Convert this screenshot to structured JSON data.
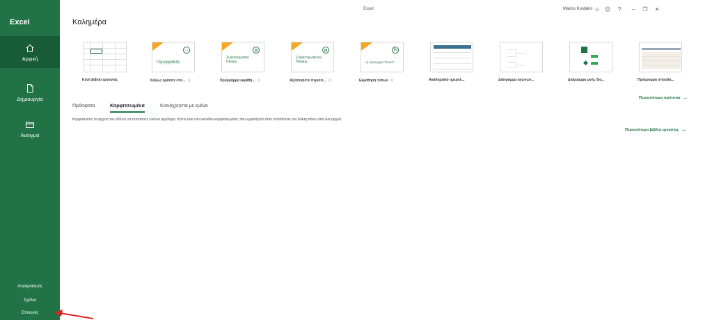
{
  "app": {
    "name": "Excel",
    "window_title": "Excel",
    "user_name": "Marios Kostakis",
    "brand_color": "#217346",
    "brand_dark": "#185c37"
  },
  "titlebar": {
    "buttons": [
      {
        "icon": "smiley-icon",
        "glyph": "☺"
      },
      {
        "icon": "frown-icon",
        "glyph": "☹"
      },
      {
        "icon": "help-icon",
        "glyph": "?"
      },
      {
        "icon": "minimize-icon",
        "glyph": "–"
      },
      {
        "icon": "restore-icon",
        "glyph": "❐"
      },
      {
        "icon": "close-icon",
        "glyph": "✕"
      }
    ]
  },
  "sidebar": {
    "items": [
      {
        "label": "Αρχική",
        "icon": "home-icon",
        "active": true
      },
      {
        "label": "Δημιουργία",
        "icon": "new-file-icon",
        "active": false
      },
      {
        "label": "Άνοιγμα",
        "icon": "folder-icon",
        "active": false
      }
    ],
    "bottom": [
      {
        "label": "Λογαριασμός"
      },
      {
        "label": "Σχόλια"
      },
      {
        "label": "Επιλογές"
      }
    ]
  },
  "main": {
    "greeting": "Καλημέρα",
    "templates": [
      {
        "label": "Κενό βιβλίο εργασίας",
        "pin": false,
        "thumb_text": ""
      },
      {
        "label": "Καλώς ορίσατε στο...",
        "pin": true,
        "thumb_text": "Περιηγηθείτε"
      },
      {
        "label": "Πρόγραμμα εκμάθη...",
        "pin": true,
        "thumb_text": "Συγκεντρωτικό Πίνακα"
      },
      {
        "label": "Αξιοποιήστε περισσ...",
        "pin": true,
        "thumb_text": "Συγκεντρωτικούς Πίνακες"
      },
      {
        "label": "Εκμάθηση τύπων",
        "pin": true,
        "thumb_text": "τη λειτουργία \"Excel\""
      },
      {
        "label": "Ακαδημαϊκό ημερολ...",
        "pin": false,
        "thumb_text": ""
      },
      {
        "label": "Διάγραμμα αγώνων...",
        "pin": false,
        "thumb_text": ""
      },
      {
        "label": "Διάγραμμα ροής δια...",
        "pin": false,
        "thumb_text": ""
      },
      {
        "label": "Πρόγραμμα σπουδα...",
        "pin": false,
        "thumb_text": ""
      }
    ],
    "more_templates": "Περισσότερα πρότυπα",
    "tabs": [
      {
        "label": "Πρόσφατα",
        "active": false
      },
      {
        "label": "Καρφιτσωμένα",
        "active": true
      },
      {
        "label": "Κοινόχρηστα με εμένα",
        "active": false
      }
    ],
    "pinned_help": "Καρφιτσώστε τα αρχεία που θέλετε να εντοπίσετε εύκολα αργότερα. Κάντε κλικ στο εικονίδιο καρφιτσώματος που εμφανίζεται όταν τοποθετείτε τον δείκτη πάνω από ένα αρχείο.",
    "more_workbooks": "Περισσότερα βιβλία εργασίας",
    "arrow_glyph": "→"
  },
  "annotation": {
    "color": "#e02020"
  }
}
